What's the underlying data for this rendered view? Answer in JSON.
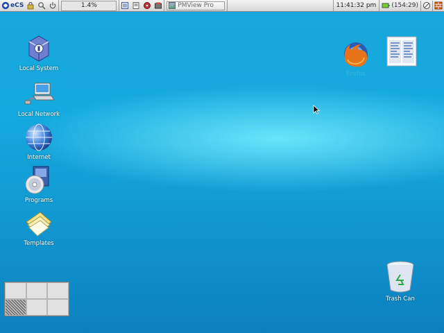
{
  "taskbar": {
    "logo": "eCS",
    "cpu_load": "1.4%",
    "window_title": "PMView Pro",
    "clock": "11:41:32 pm",
    "battery": "(154:29)"
  },
  "desktop": {
    "icons": [
      {
        "label": "Local System",
        "icon": "local-system-icon"
      },
      {
        "label": "Local Network",
        "icon": "local-network-icon"
      },
      {
        "label": "Internet",
        "icon": "globe-icon"
      },
      {
        "label": "Programs",
        "icon": "programs-cd-icon"
      },
      {
        "label": "Templates",
        "icon": "templates-icon"
      },
      {
        "label": "Firefox",
        "icon": "firefox-icon"
      },
      {
        "label": "Trash Can",
        "icon": "trash-can-icon"
      }
    ]
  },
  "pager": {
    "desktops": 6,
    "active_index": 3
  }
}
